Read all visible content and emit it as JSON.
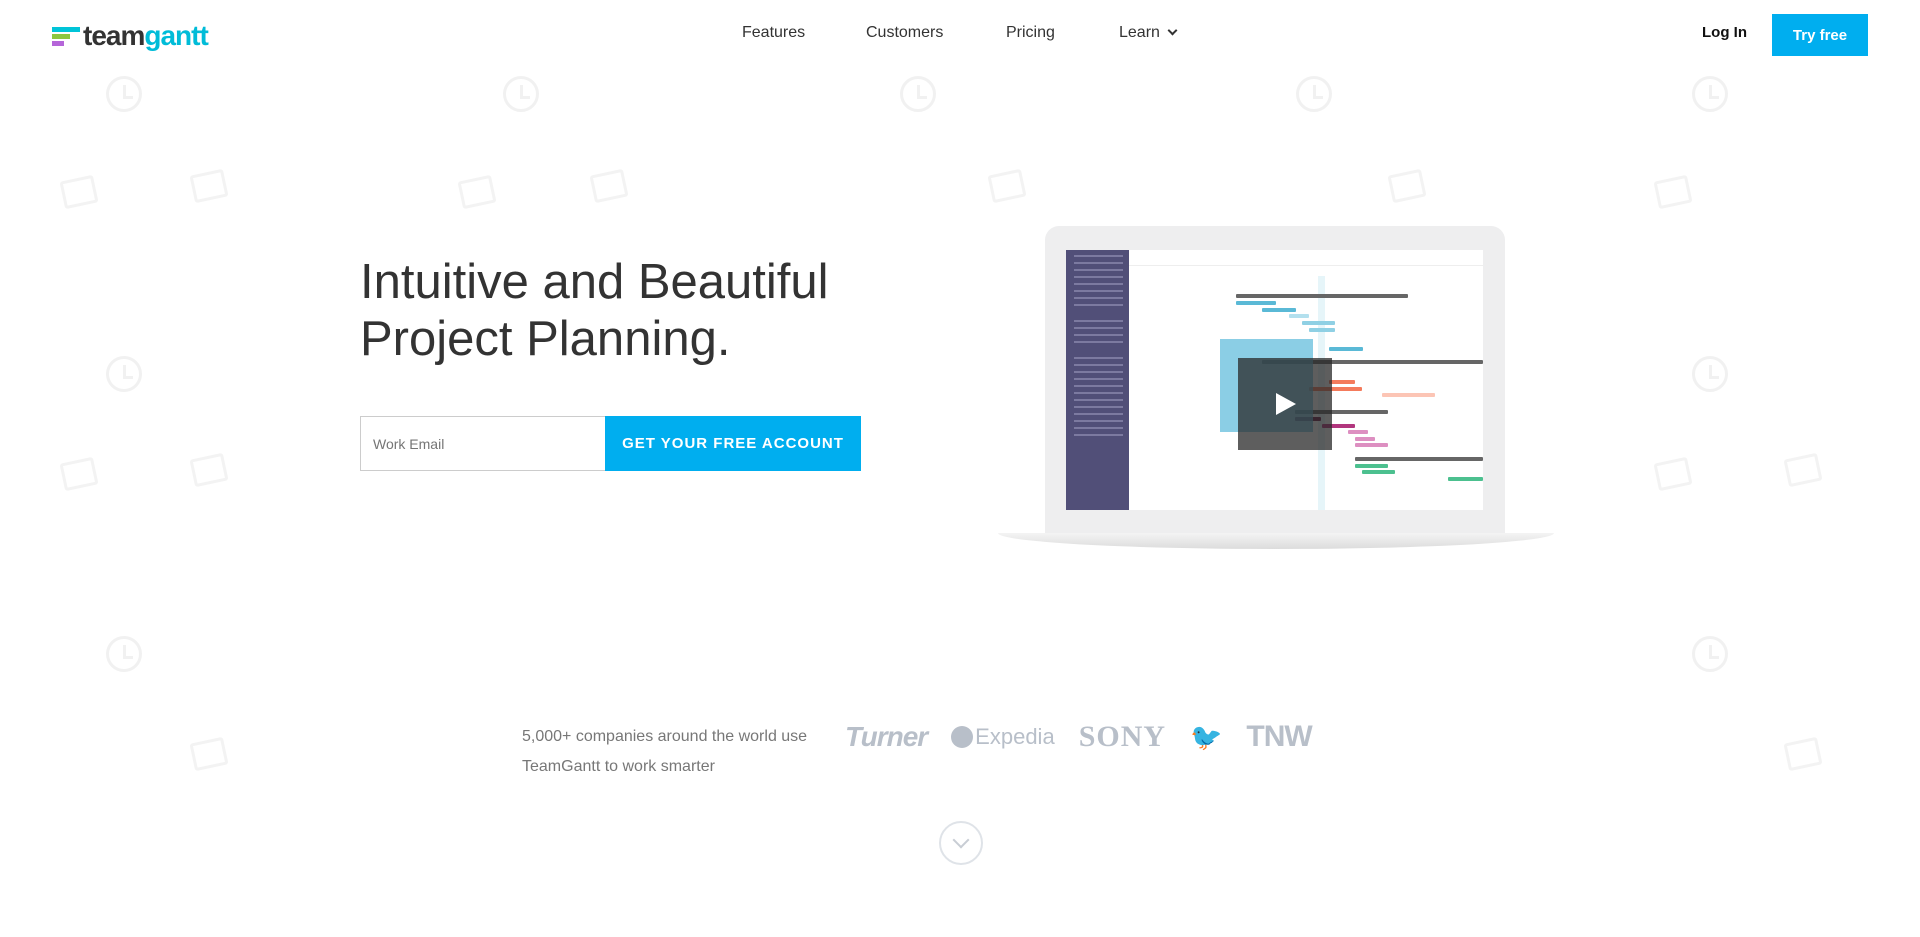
{
  "header": {
    "logo": {
      "part1": "team",
      "part2": "gantt",
      "bar_colors": [
        "#00c4d8",
        "#8cc63f",
        "#b565d9"
      ]
    },
    "nav": [
      "Features",
      "Customers",
      "Pricing",
      "Learn"
    ],
    "login": "Log In",
    "try_free": "Try free"
  },
  "hero": {
    "title_line1": "Intuitive and Beautiful",
    "title_line2": "Project Planning.",
    "email_placeholder": "Work Email",
    "cta": "GET YOUR FREE ACCOUNT"
  },
  "social_proof": {
    "line1": "5,000+ companies around the world use",
    "line2": "TeamGantt to work smarter",
    "brands": [
      "Turner",
      "Expedia",
      "SONY",
      "twitter",
      "TNW"
    ]
  },
  "colors": {
    "accent": "#00aeef",
    "brand_logos": "#b8bfc9",
    "sidebar": "#514f78"
  }
}
